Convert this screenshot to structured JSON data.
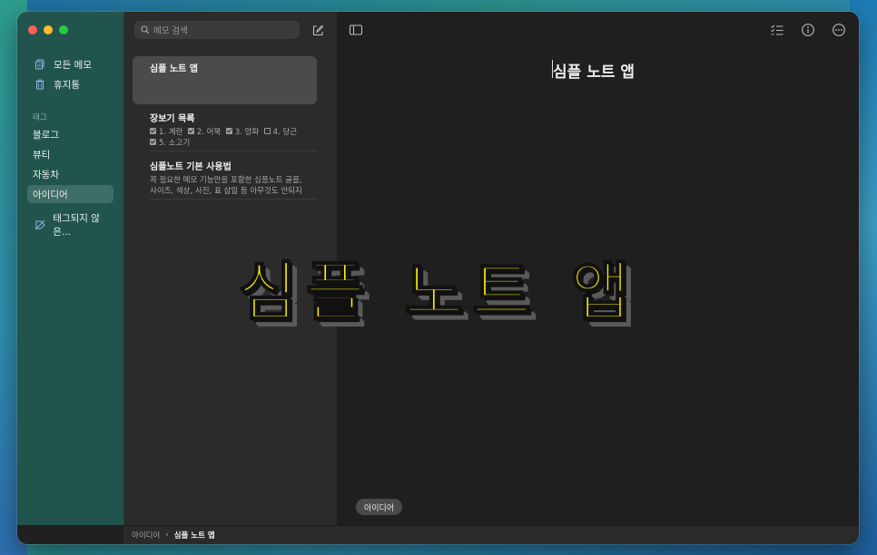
{
  "sidebar": {
    "items": [
      {
        "label": "모든 메모",
        "icon": "notes-icon"
      },
      {
        "label": "휴지통",
        "icon": "trash-icon"
      }
    ],
    "tags_header": "태그",
    "tags": [
      "블로그",
      "뷰티",
      "자동차",
      "아이디어"
    ],
    "active_tag": "아이디어",
    "untagged": {
      "label": "태그되지 않은...",
      "icon": "untagged-icon"
    }
  },
  "list": {
    "search_placeholder": "메모 검색",
    "notes": [
      {
        "title": "심플 노트 앱",
        "preview": ""
      },
      {
        "title": "장보기 목록",
        "checklist": [
          {
            "label": "1. 계란",
            "checked": true
          },
          {
            "label": "2. 어묵",
            "checked": true
          },
          {
            "label": "3. 양파",
            "checked": true
          },
          {
            "label": "4. 당근",
            "checked": false
          },
          {
            "label": "5. 소고기",
            "checked": true
          }
        ]
      },
      {
        "title": "심플노트 기본 사용법",
        "preview_line1": "꼭 필요한 메모 기능만을 포함한 심플노트 글꼴,",
        "preview_line2": "사이즈, 색상, 사진, 표 삽입 등 아무것도 안되지"
      }
    ]
  },
  "editor": {
    "title": "심플 노트 앱",
    "tag_pill": "아이디어"
  },
  "footer": {
    "crumb_parent": "아이디어",
    "crumb_current": "심플 노트 앱"
  },
  "overlay": {
    "text": "심플 노트 앱"
  }
}
